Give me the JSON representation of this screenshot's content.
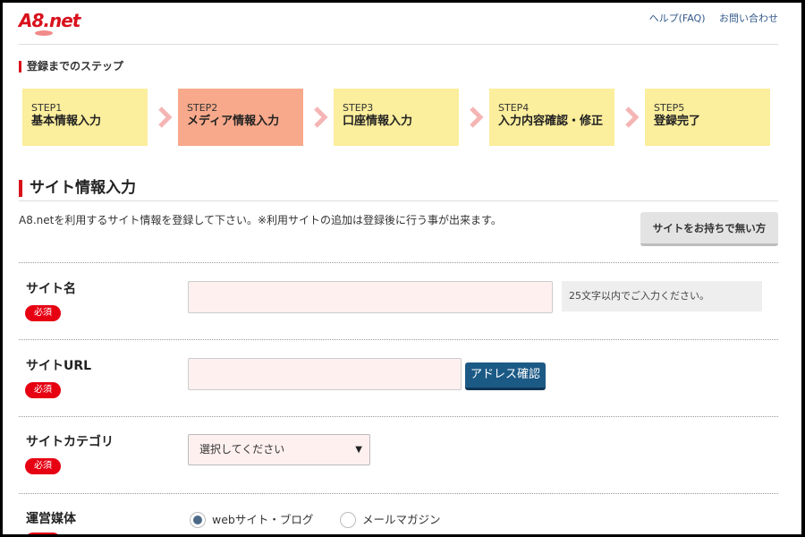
{
  "header": {
    "logo_text": "A8.net",
    "help_label": "ヘルプ(FAQ)",
    "contact_label": "お問い合わせ"
  },
  "steps": {
    "heading": "登録までのステップ",
    "items": [
      {
        "num": "STEP1",
        "name": "基本情報入力",
        "active": false
      },
      {
        "num": "STEP2",
        "name": "メディア情報入力",
        "active": true
      },
      {
        "num": "STEP3",
        "name": "口座情報入力",
        "active": false
      },
      {
        "num": "STEP4",
        "name": "入力内容確認・修正",
        "active": false
      },
      {
        "num": "STEP5",
        "name": "登録完了",
        "active": false
      }
    ]
  },
  "site_info": {
    "title": "サイト情報入力",
    "description": "A8.netを利用するサイト情報を登録して下さい。※利用サイトの追加は登録後に行う事が出来ます。",
    "no_site_button": "サイトをお持ちで無い方"
  },
  "form": {
    "required_badge": "必須",
    "site_name": {
      "label": "サイト名",
      "value": "",
      "hint": "25文字以内でご入力ください。"
    },
    "site_url": {
      "label": "サイトURL",
      "value": "",
      "check_button": "アドレス確認"
    },
    "site_category": {
      "label": "サイトカテゴリ",
      "selected": "選択してください"
    },
    "media": {
      "label": "運営媒体",
      "options": [
        {
          "label": "webサイト・ブログ",
          "checked": true
        },
        {
          "label": "メールマガジン",
          "checked": false
        }
      ]
    }
  },
  "colors": {
    "brand_red": "#d9111c",
    "step_inactive": "#fbee9c",
    "step_active": "#f8a98b",
    "button_blue": "#1c5a86"
  }
}
